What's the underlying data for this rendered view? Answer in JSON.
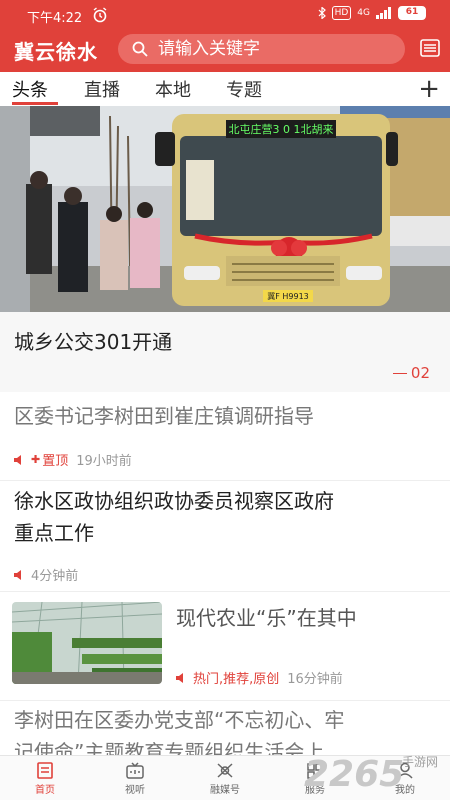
{
  "status_bar": {
    "time": "下午4:22",
    "network": "4G",
    "battery": "61"
  },
  "app": {
    "logo": "冀云徐水",
    "search_placeholder": "请输入关键字"
  },
  "tabs": [
    {
      "label": "头条",
      "active": true
    },
    {
      "label": "直播",
      "active": false
    },
    {
      "label": "本地",
      "active": false
    },
    {
      "label": "专题",
      "active": false
    }
  ],
  "hero": {
    "title": "城乡公交301开通",
    "page_indicator": "02",
    "bus_sign": "北屯庄营3 0 1北胡来",
    "plate": "冀F H9913"
  },
  "articles": [
    {
      "title": "区委书记李树田到崔庄镇调研指导",
      "tag": "置顶",
      "time": "19小时前"
    },
    {
      "title_line1": "徐水区政协组织政协委员视察区政府",
      "title_line2": "重点工作",
      "time": "4分钟前"
    },
    {
      "title": "现代农业“乐”在其中",
      "tags": "热门,推荐,原创",
      "time": "16分钟前"
    },
    {
      "title_line1": "李树田在区委办党支部“不忘初心、牢",
      "title_line2": "记使命”主题教育专题组织生活会上"
    }
  ],
  "bottom_nav": [
    {
      "label": "首页",
      "icon": "home-icon",
      "active": true
    },
    {
      "label": "视听",
      "icon": "tv-icon",
      "active": false
    },
    {
      "label": "融媒号",
      "icon": "media-icon",
      "active": false
    },
    {
      "label": "服务",
      "icon": "service-icon",
      "active": false
    },
    {
      "label": "我的",
      "icon": "profile-icon",
      "active": false
    }
  ],
  "watermark": {
    "main": "2265",
    "sub": "手游网"
  },
  "colors": {
    "accent": "#e0413a",
    "search_bg": "#ea6b65",
    "muted_text": "#999999"
  }
}
